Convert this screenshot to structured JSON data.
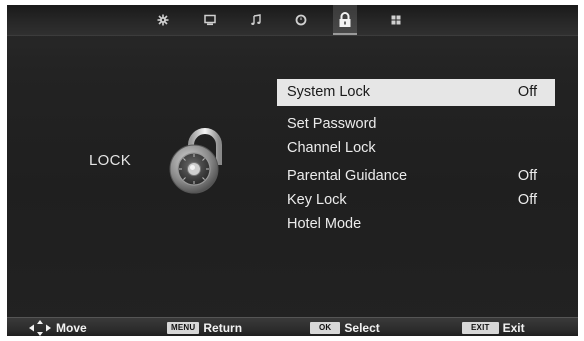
{
  "top_bar": {
    "icons": [
      {
        "name": "picture-settings-icon"
      },
      {
        "name": "screen-icon"
      },
      {
        "name": "music-note-icon"
      },
      {
        "name": "clock-icon"
      },
      {
        "name": "lock-icon",
        "active": true
      },
      {
        "name": "grid-icon"
      }
    ]
  },
  "section": {
    "title": "LOCK"
  },
  "menu": {
    "items": [
      {
        "label": "System Lock",
        "value": "Off",
        "selected": true
      },
      {
        "label": "Set Password",
        "value": ""
      },
      {
        "label": "Channel Lock",
        "value": ""
      },
      {
        "label": "Parental Guidance",
        "value": "Off"
      },
      {
        "label": "Key Lock",
        "value": "Off"
      },
      {
        "label": "Hotel Mode",
        "value": ""
      }
    ]
  },
  "bottom_bar": {
    "move_label": "Move",
    "menu_key": "MENU",
    "return_label": "Return",
    "ok_key": "OK",
    "select_label": "Select",
    "exit_key": "EXIT",
    "exit_label": "Exit"
  },
  "colors": {
    "background": "#222222",
    "highlight": "#e6e6e6",
    "text": "#ececec"
  }
}
